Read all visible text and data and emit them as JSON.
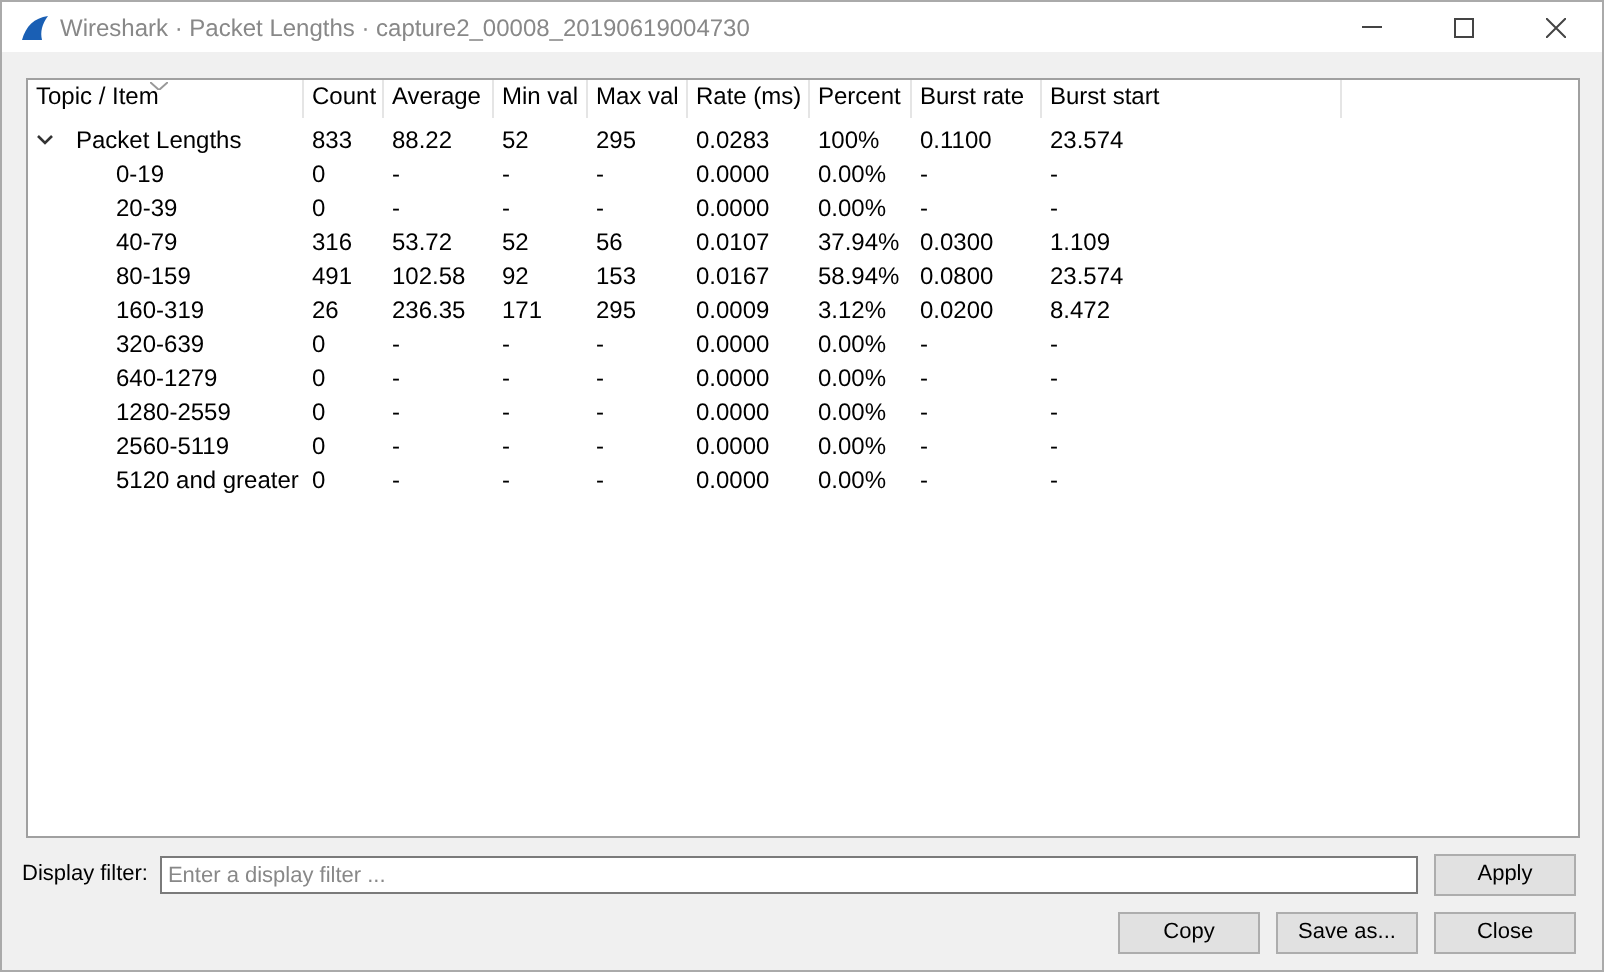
{
  "window": {
    "title": "Wireshark · Packet Lengths · capture2_00008_20190619004730"
  },
  "table": {
    "columns": [
      "Topic / Item",
      "Count",
      "Average",
      "Min val",
      "Max val",
      "Rate (ms)",
      "Percent",
      "Burst rate",
      "Burst start"
    ],
    "rows": [
      {
        "item": "Packet Lengths",
        "expanded": true,
        "values": [
          "833",
          "88.22",
          "52",
          "295",
          "0.0283",
          "100%",
          "0.1100",
          "23.574"
        ],
        "children": [
          {
            "item": "0-19",
            "values": [
              "0",
              "-",
              "-",
              "-",
              "0.0000",
              "0.00%",
              "-",
              "-"
            ]
          },
          {
            "item": "20-39",
            "values": [
              "0",
              "-",
              "-",
              "-",
              "0.0000",
              "0.00%",
              "-",
              "-"
            ]
          },
          {
            "item": "40-79",
            "values": [
              "316",
              "53.72",
              "52",
              "56",
              "0.0107",
              "37.94%",
              "0.0300",
              "1.109"
            ]
          },
          {
            "item": "80-159",
            "values": [
              "491",
              "102.58",
              "92",
              "153",
              "0.0167",
              "58.94%",
              "0.0800",
              "23.574"
            ]
          },
          {
            "item": "160-319",
            "values": [
              "26",
              "236.35",
              "171",
              "295",
              "0.0009",
              "3.12%",
              "0.0200",
              "8.472"
            ]
          },
          {
            "item": "320-639",
            "values": [
              "0",
              "-",
              "-",
              "-",
              "0.0000",
              "0.00%",
              "-",
              "-"
            ]
          },
          {
            "item": "640-1279",
            "values": [
              "0",
              "-",
              "-",
              "-",
              "0.0000",
              "0.00%",
              "-",
              "-"
            ]
          },
          {
            "item": "1280-2559",
            "values": [
              "0",
              "-",
              "-",
              "-",
              "0.0000",
              "0.00%",
              "-",
              "-"
            ]
          },
          {
            "item": "2560-5119",
            "values": [
              "0",
              "-",
              "-",
              "-",
              "0.0000",
              "0.00%",
              "-",
              "-"
            ]
          },
          {
            "item": "5120 and greater",
            "values": [
              "0",
              "-",
              "-",
              "-",
              "0.0000",
              "0.00%",
              "-",
              "-"
            ]
          }
        ]
      }
    ]
  },
  "filter": {
    "label": "Display filter:",
    "placeholder": "Enter a display filter ...",
    "button": "Apply"
  },
  "buttons": [
    "Copy",
    "Save as...",
    "Close"
  ]
}
